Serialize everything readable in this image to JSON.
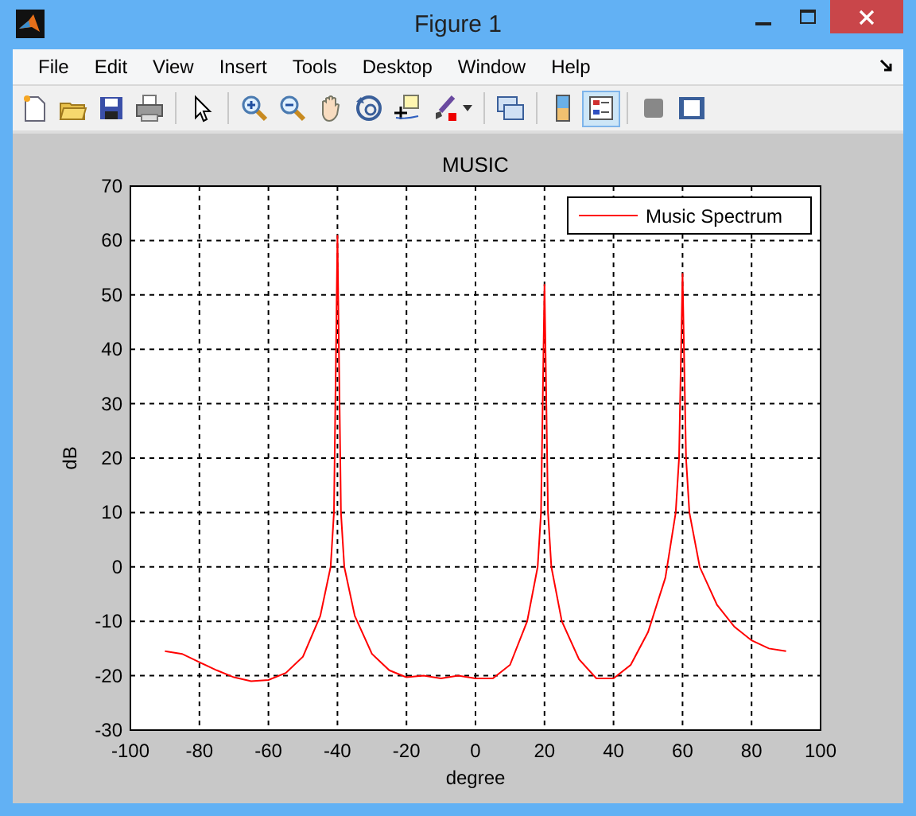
{
  "window": {
    "title": "Figure 1"
  },
  "menu": [
    {
      "label": "File"
    },
    {
      "label": "Edit"
    },
    {
      "label": "View"
    },
    {
      "label": "Insert"
    },
    {
      "label": "Tools"
    },
    {
      "label": "Desktop"
    },
    {
      "label": "Window"
    },
    {
      "label": "Help"
    }
  ],
  "toolbar": [
    {
      "kind": "new",
      "selected": false
    },
    {
      "kind": "open",
      "selected": false
    },
    {
      "kind": "save",
      "selected": false
    },
    {
      "kind": "print",
      "selected": false
    },
    {
      "kind": "sep"
    },
    {
      "kind": "pointer",
      "selected": false
    },
    {
      "kind": "sep"
    },
    {
      "kind": "zoom-in",
      "selected": false
    },
    {
      "kind": "zoom-out",
      "selected": false
    },
    {
      "kind": "pan",
      "selected": false
    },
    {
      "kind": "rotate",
      "selected": false
    },
    {
      "kind": "datacursor",
      "selected": false
    },
    {
      "kind": "brush",
      "selected": false
    },
    {
      "kind": "sep"
    },
    {
      "kind": "link",
      "selected": false
    },
    {
      "kind": "sep"
    },
    {
      "kind": "colorbar",
      "selected": false
    },
    {
      "kind": "legend",
      "selected": true
    },
    {
      "kind": "sep"
    },
    {
      "kind": "hide-tools",
      "selected": false
    },
    {
      "kind": "show-tools",
      "selected": false
    }
  ],
  "chart_data": {
    "type": "line",
    "grid": true,
    "title": "MUSIC",
    "xlabel": "degree",
    "ylabel": "dB",
    "xlim": [
      -100,
      100
    ],
    "ylim": [
      -30,
      70
    ],
    "xticks": [
      -100,
      -80,
      -60,
      -40,
      -20,
      0,
      20,
      40,
      60,
      80,
      100
    ],
    "yticks": [
      -30,
      -20,
      -10,
      0,
      10,
      20,
      30,
      40,
      50,
      60,
      70
    ],
    "x": [
      -90,
      -85,
      -80,
      -75,
      -70,
      -65,
      -60,
      -55,
      -50,
      -45,
      -42,
      -41,
      -40,
      -39,
      -38,
      -35,
      -30,
      -25,
      -20,
      -15,
      -10,
      -5,
      0,
      5,
      10,
      15,
      18,
      19,
      20,
      21,
      22,
      25,
      30,
      35,
      40,
      45,
      50,
      55,
      58,
      59,
      60,
      61,
      62,
      65,
      70,
      75,
      80,
      85,
      90
    ],
    "series": [
      {
        "name": "Music Spectrum",
        "color": "#ff0000",
        "values": [
          -15.5,
          -16,
          -17.5,
          -19,
          -20.3,
          -21,
          -20.8,
          -19.5,
          -16.5,
          -9,
          0,
          10,
          61,
          10,
          0,
          -9,
          -16,
          -19,
          -20.3,
          -20,
          -20.5,
          -20,
          -20.5,
          -20.5,
          -18,
          -10,
          0,
          10,
          52,
          10,
          0,
          -10,
          -17,
          -20.5,
          -20.5,
          -18,
          -12,
          -2,
          10,
          20,
          54,
          20,
          10,
          0,
          -7,
          -11,
          -13.5,
          -15,
          -15.5
        ]
      }
    ]
  }
}
